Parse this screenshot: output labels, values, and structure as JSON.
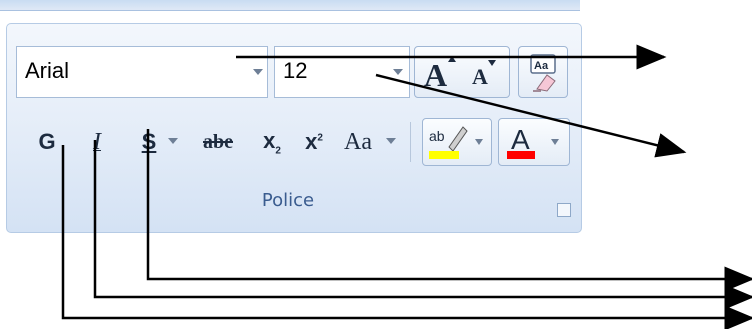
{
  "header_text": "...) ",
  "ribbon": {
    "font_name": "Arial",
    "font_size": "12",
    "group_label": "Police"
  },
  "buttons": {
    "bold": "G",
    "italic": "I",
    "underline": "S",
    "strikethrough": "abe",
    "subscript": "x",
    "superscript": "x",
    "change_case": "Aa"
  },
  "colors": {
    "highlight": "#ffff00",
    "font_color": "#ff0000",
    "arrow": "#000000"
  }
}
